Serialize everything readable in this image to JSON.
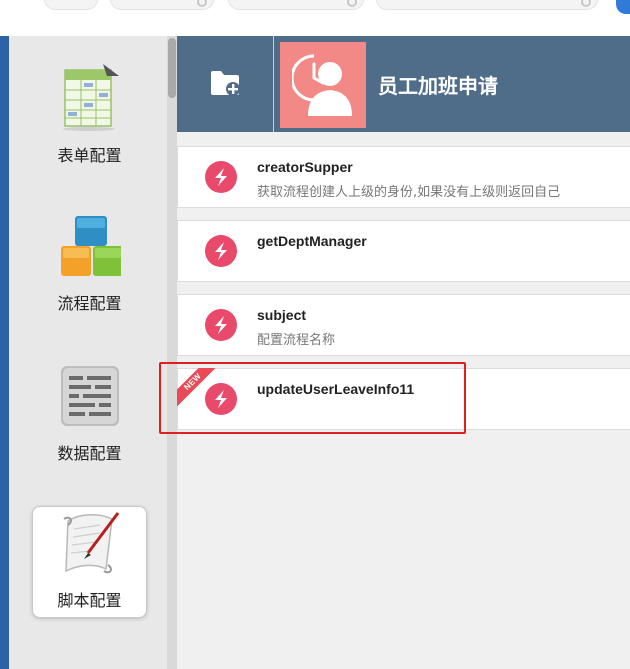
{
  "sidebar": {
    "items": [
      {
        "label": "表单配置",
        "icon": "form-config-icon",
        "active": false
      },
      {
        "label": "流程配置",
        "icon": "flow-config-icon",
        "active": false
      },
      {
        "label": "数据配置",
        "icon": "data-config-icon",
        "active": false
      },
      {
        "label": "脚本配置",
        "icon": "script-config-icon",
        "active": true
      }
    ]
  },
  "header": {
    "title": "员工加班申请",
    "add_icon": "folder-add-icon",
    "avatar_icon": "employee-overtime-icon"
  },
  "scripts": [
    {
      "name": "creatorSupper",
      "desc": "获取流程创建人上级的身份,如果没有上级则返回自己",
      "badge": ""
    },
    {
      "name": "getDeptManager",
      "desc": "",
      "badge": ""
    },
    {
      "name": "subject",
      "desc": "配置流程名称",
      "badge": ""
    },
    {
      "name": "updateUserLeaveInfo11",
      "desc": "",
      "badge": "NEW"
    }
  ],
  "colors": {
    "header_bg": "#4f6c89",
    "avatar_bg": "#f28987",
    "script_icon": "#e94a6b",
    "highlight": "#e02020",
    "sidebar_bg": "#e8e8e8"
  }
}
